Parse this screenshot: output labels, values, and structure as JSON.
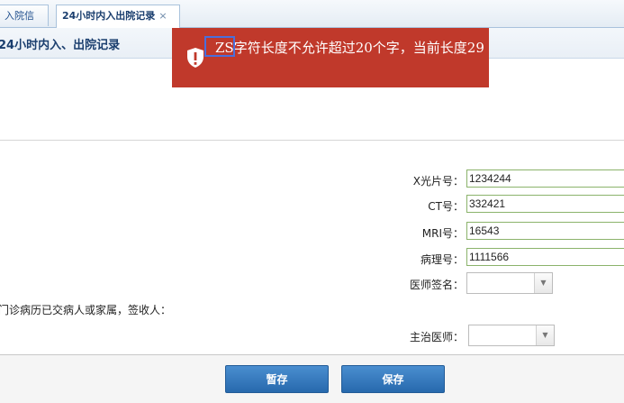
{
  "tabs": [
    {
      "label": "入院信息"
    },
    {
      "label": "24小时内入出院记录",
      "close": "×"
    }
  ],
  "panel": {
    "title": "24小时内入、出院记录"
  },
  "toast": {
    "message_prefix": "ZS",
    "message": "字符长度不允许超过20个字，当前长度29",
    "color": "#c0392b"
  },
  "form": {
    "xray": {
      "label": "X光片号：",
      "value": "1234244"
    },
    "ct": {
      "label": "CT号：",
      "value": "332421"
    },
    "mri": {
      "label": "MRI号：",
      "value": "16543"
    },
    "pathology": {
      "label": "病理号：",
      "value": "1111566"
    },
    "doctor_sign": {
      "label": "医师签名：",
      "value": ""
    },
    "note": "门诊病历已交病人或家属，签收人：",
    "attending": {
      "label": "主治医师：",
      "value": ""
    }
  },
  "buttons": {
    "temp_save": "暂存",
    "save": "保存"
  }
}
